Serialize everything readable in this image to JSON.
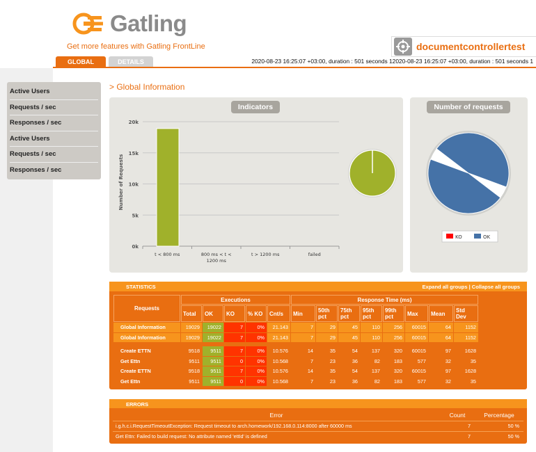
{
  "header": {
    "logo_text": "Gatling",
    "tagline": "Get more features with Gatling FrontLine",
    "simulation_name": "documentcontrollertest",
    "run_info": "2020-08-23 16:25:07 +03:00, duration : 501 seconds 12020-08-23 16:25:07 +03:00, duration : 501 seconds 1"
  },
  "tabs": {
    "global": "GLOBAL",
    "details": "DETAILS"
  },
  "sidebar": {
    "items": [
      {
        "label": "Active Users"
      },
      {
        "label": "Requests / sec"
      },
      {
        "label": "Responses / sec"
      },
      {
        "label": "Active Users"
      },
      {
        "label": "Requests / sec"
      },
      {
        "label": "Responses / sec"
      }
    ]
  },
  "section_title": "> Global Information",
  "indicators": {
    "title": "Indicators",
    "chart_data": {
      "type": "bar",
      "categories": [
        "t < 800 ms",
        "800 ms < t < 1200 ms",
        "t > 1200 ms",
        "failed"
      ],
      "category_lines": [
        [
          "t < 800 ms"
        ],
        [
          "800 ms < t <",
          "1200 ms"
        ],
        [
          "t > 1200 ms"
        ],
        [
          "failed"
        ]
      ],
      "values": [
        18900,
        0,
        0,
        0
      ],
      "ylabel": "Number of Requests",
      "ylim": [
        0,
        20000
      ],
      "yticks": [
        "0k",
        "5k",
        "10k",
        "15k",
        "20k"
      ],
      "bar_color": "#a0b12b"
    },
    "pie": {
      "ok_fraction": 0.9996,
      "ok_color": "#a0b12b"
    }
  },
  "number_of_requests": {
    "title": "Number of requests",
    "chart_data": {
      "type": "pie",
      "slices": [
        {
          "name": "OK",
          "value": 2,
          "color": "#4572a7"
        },
        {
          "name": "KO",
          "value": 0,
          "color": "#ff0000"
        },
        {
          "name": "OK",
          "value": 2,
          "color": "#4572a7"
        },
        {
          "name": "KO",
          "value": 0,
          "color": "#ff0000"
        }
      ],
      "legend": [
        "KO",
        "OK"
      ]
    }
  },
  "statistics": {
    "title": "STATISTICS",
    "expand_label": "Expand all groups | Collapse all groups",
    "group_headers": {
      "requests": "Requests",
      "executions": "Executions",
      "response_time": "Response Time (ms)"
    },
    "columns": [
      "Total",
      "OK",
      "KO",
      "% KO",
      "Cnt/s",
      "Min",
      "50th pct",
      "75th pct",
      "95th pct",
      "99th pct",
      "Max",
      "Mean",
      "Std Dev"
    ],
    "global_rows": [
      [
        "Global Information",
        "19029",
        "19022",
        "7",
        "0%",
        "21.143",
        "7",
        "29",
        "45",
        "110",
        "256",
        "60015",
        "64",
        "1152"
      ],
      [
        "Global Information",
        "19029",
        "19022",
        "7",
        "0%",
        "21.143",
        "7",
        "29",
        "45",
        "110",
        "256",
        "60015",
        "64",
        "1152"
      ]
    ],
    "request_rows": [
      [
        "Create ETTN",
        "9518",
        "9511",
        "7",
        "0%",
        "10.576",
        "14",
        "35",
        "54",
        "137",
        "320",
        "60015",
        "97",
        "1628"
      ],
      [
        "Get Ettn",
        "9511",
        "9511",
        "0",
        "0%",
        "10.568",
        "7",
        "23",
        "36",
        "82",
        "183",
        "577",
        "32",
        "35"
      ],
      [
        "Create ETTN",
        "9518",
        "9511",
        "7",
        "0%",
        "10.576",
        "14",
        "35",
        "54",
        "137",
        "320",
        "60015",
        "97",
        "1628"
      ],
      [
        "Get Ettn",
        "9511",
        "9511",
        "0",
        "0%",
        "10.568",
        "7",
        "23",
        "36",
        "82",
        "183",
        "577",
        "32",
        "35"
      ]
    ]
  },
  "errors": {
    "title": "ERRORS",
    "columns": [
      "Error",
      "Count",
      "Percentage"
    ],
    "rows": [
      [
        "i.g.h.c.i.RequestTimeoutException: Request timeout to arch.homework/192.168.0.114:8000 after 60000 ms",
        "7",
        "50 %"
      ],
      [
        "Get Ettn: Failed to build request: No attribute named 'ettId' is defined",
        "7",
        "50 %"
      ]
    ]
  },
  "colors": {
    "accent": "#e96e11",
    "accent_light": "#f7941d",
    "ok": "#a0b12b",
    "ko": "#ff3300",
    "panel": "#e7e6e1"
  }
}
